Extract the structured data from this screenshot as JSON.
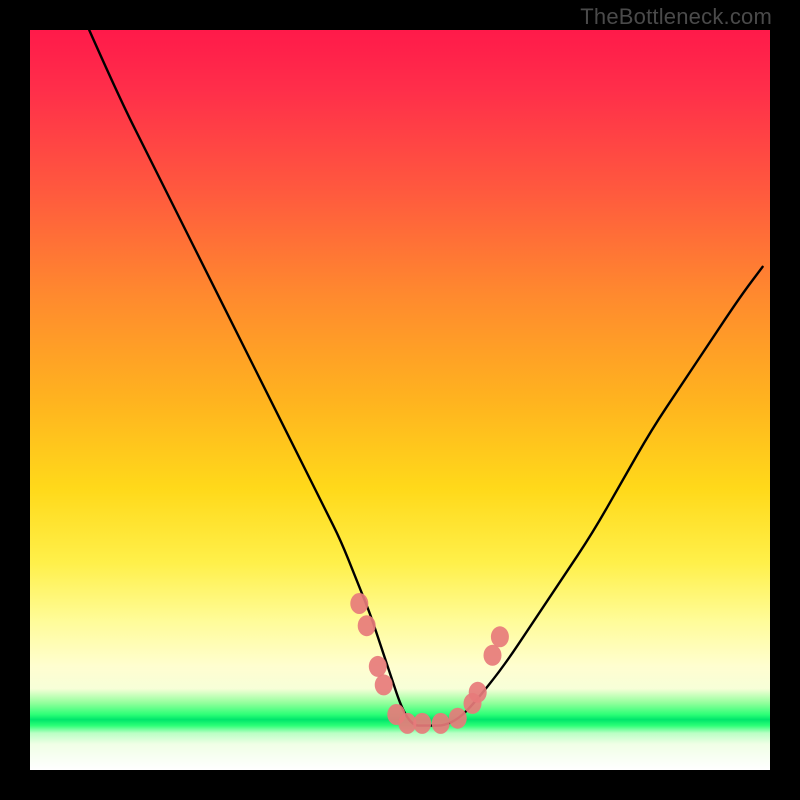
{
  "watermark": "TheBottleneck.com",
  "chart_data": {
    "type": "line",
    "title": "",
    "xlabel": "",
    "ylabel": "",
    "xlim": [
      0,
      100
    ],
    "ylim": [
      0,
      100
    ],
    "grid": false,
    "series": [
      {
        "name": "curve",
        "color": "#000000",
        "x": [
          8,
          12,
          16,
          20,
          24,
          28,
          32,
          36,
          40,
          42,
          44,
          46,
          47,
          48,
          49,
          50,
          51,
          52,
          53,
          54,
          56,
          58,
          60,
          64,
          68,
          72,
          76,
          80,
          84,
          88,
          92,
          96,
          99
        ],
        "values": [
          100,
          91,
          83,
          75,
          67,
          59,
          51,
          43,
          35,
          31,
          26,
          21,
          18,
          15,
          12,
          9,
          7,
          6,
          6,
          6,
          6,
          7,
          9,
          14,
          20,
          26,
          32,
          39,
          46,
          52,
          58,
          64,
          68
        ]
      }
    ],
    "markers": {
      "name": "highlight-points",
      "color": "#e77b7b",
      "points": [
        {
          "x": 44.5,
          "y": 22.5
        },
        {
          "x": 45.5,
          "y": 19.5
        },
        {
          "x": 47.0,
          "y": 14.0
        },
        {
          "x": 47.8,
          "y": 11.5
        },
        {
          "x": 49.5,
          "y": 7.5
        },
        {
          "x": 51.0,
          "y": 6.3
        },
        {
          "x": 53.0,
          "y": 6.3
        },
        {
          "x": 55.5,
          "y": 6.3
        },
        {
          "x": 57.8,
          "y": 7.0
        },
        {
          "x": 59.8,
          "y": 9.0
        },
        {
          "x": 60.5,
          "y": 10.5
        },
        {
          "x": 62.5,
          "y": 15.5
        },
        {
          "x": 63.5,
          "y": 18.0
        }
      ]
    }
  }
}
